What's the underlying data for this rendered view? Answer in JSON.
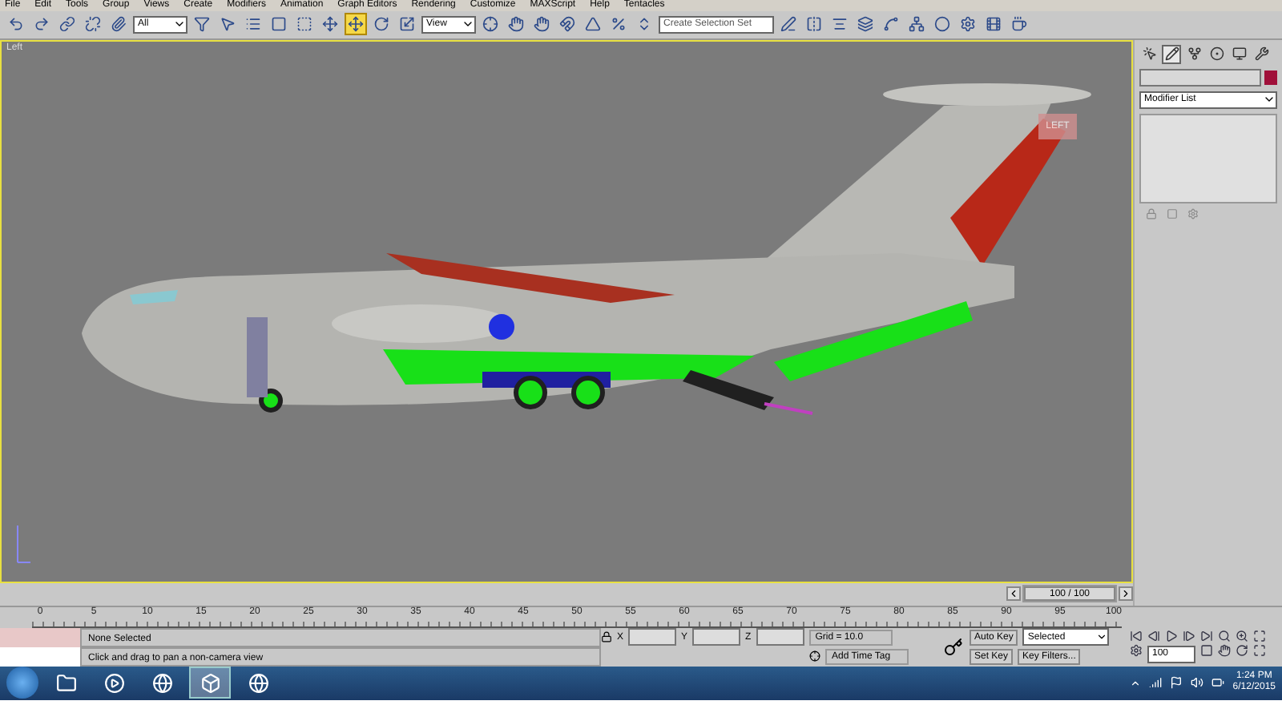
{
  "menu_bar": [
    "File",
    "Edit",
    "Tools",
    "Group",
    "Views",
    "Create",
    "Modifiers",
    "Animation",
    "Graph Editors",
    "Rendering",
    "Customize",
    "MAXScript",
    "Help",
    "Tentacles"
  ],
  "toolbar": {
    "selection_filter": "All",
    "reference_coord": "View",
    "selection_set": {
      "placeholder": "Create Selection Set"
    },
    "tools": [
      {
        "kind": "undo",
        "selected": false
      },
      {
        "kind": "redo",
        "selected": false
      },
      {
        "kind": "link",
        "selected": false
      },
      {
        "kind": "unlink",
        "selected": false
      },
      {
        "kind": "bind",
        "selected": false
      },
      {
        "kind": "filter",
        "selected": false
      },
      {
        "kind": "select",
        "selected": false
      },
      {
        "kind": "select-name",
        "selected": false
      },
      {
        "kind": "region",
        "selected": false
      },
      {
        "kind": "window",
        "selected": false
      },
      {
        "kind": "move",
        "selected": false
      },
      {
        "kind": "move",
        "selected": true
      },
      {
        "kind": "rotate",
        "selected": false
      },
      {
        "kind": "scale",
        "selected": false
      },
      {
        "kind": "ref",
        "selected": false
      },
      {
        "kind": "pivot",
        "selected": false
      },
      {
        "kind": "manipulate",
        "selected": false
      },
      {
        "kind": "snap",
        "selected": false
      },
      {
        "kind": "angle",
        "selected": false
      },
      {
        "kind": "percent",
        "selected": false
      },
      {
        "kind": "spinner",
        "selected": false
      },
      {
        "kind": "edit-set",
        "selected": false
      },
      {
        "kind": "mirror",
        "selected": false
      },
      {
        "kind": "align",
        "selected": false
      },
      {
        "kind": "layers",
        "selected": false
      },
      {
        "kind": "curve",
        "selected": false
      },
      {
        "kind": "schematic",
        "selected": false
      },
      {
        "kind": "material",
        "selected": false
      },
      {
        "kind": "render-setup",
        "selected": false
      },
      {
        "kind": "frame",
        "selected": false
      },
      {
        "kind": "teapot",
        "selected": false
      }
    ]
  },
  "viewport": {
    "label": "Left",
    "viewcube_label": "LEFT"
  },
  "command_panel": {
    "tabs": [
      {
        "kind": "create",
        "selected": false
      },
      {
        "kind": "modify",
        "selected": true
      },
      {
        "kind": "hierarchy",
        "selected": false
      },
      {
        "kind": "motion",
        "selected": false
      },
      {
        "kind": "display",
        "selected": false
      },
      {
        "kind": "utilities",
        "selected": false
      }
    ],
    "modifier_list": "Modifier List"
  },
  "time_slider": {
    "label": "100 / 100",
    "level": 1
  },
  "track_bar": {
    "ticks": [
      "0",
      "5",
      "10",
      "15",
      "20",
      "25",
      "30",
      "35",
      "40",
      "45",
      "50",
      "55",
      "60",
      "65",
      "70",
      "75",
      "80",
      "85",
      "90",
      "95",
      "100"
    ]
  },
  "status_bar": {
    "selection": "None Selected",
    "prompt": "Click and drag to pan a non-camera view",
    "x_label": "X",
    "y_label": "Y",
    "z_label": "Z",
    "grid": "Grid = 10.0",
    "add_time_tag": "Add Time Tag",
    "auto_key": "Auto Key",
    "key_mode": "Selected",
    "set_key": "Set Key",
    "key_filters": "Key Filters...",
    "frame": "100"
  },
  "taskbar": {
    "apps": [
      {
        "kind": "folder",
        "selected": false
      },
      {
        "kind": "media",
        "selected": false
      },
      {
        "kind": "browser",
        "selected": false
      },
      {
        "kind": "max",
        "selected": true
      },
      {
        "kind": "browser",
        "selected": false
      }
    ],
    "time": "1:24 PM",
    "date": "6/12/2015"
  }
}
